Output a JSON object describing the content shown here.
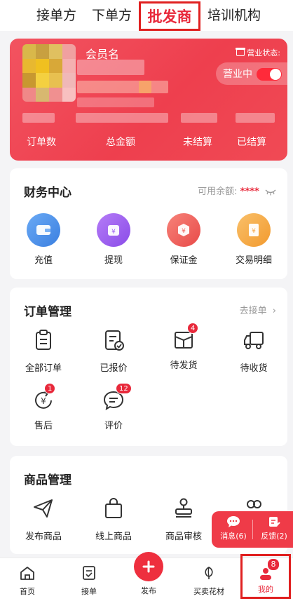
{
  "top_tabs": [
    "接单方",
    "下单方",
    "批发商",
    "培训机构"
  ],
  "member_card": {
    "name_label": "会员名",
    "status_label": "营业状态:",
    "status_value": "营业中",
    "status_on": true,
    "stats": [
      "订单数",
      "总金额",
      "未结算",
      "已结算"
    ]
  },
  "finance": {
    "title": "财务中心",
    "balance_label": "可用余额:",
    "balance_value": "****",
    "items": [
      {
        "label": "充值",
        "icon": "wallet-icon",
        "color": "#4a90e8"
      },
      {
        "label": "提现",
        "icon": "withdraw-icon",
        "color": "#9b5ef0"
      },
      {
        "label": "保证金",
        "icon": "deposit-icon",
        "color": "#f0605a"
      },
      {
        "label": "交易明细",
        "icon": "ledger-icon",
        "color": "#f5a645"
      }
    ]
  },
  "orders": {
    "title": "订单管理",
    "link": "去接单",
    "items": [
      {
        "label": "全部订单",
        "icon": "clipboard-icon",
        "badge": ""
      },
      {
        "label": "已报价",
        "icon": "quoted-icon",
        "badge": ""
      },
      {
        "label": "待发货",
        "icon": "box-icon",
        "badge": "4"
      },
      {
        "label": "待收货",
        "icon": "truck-icon",
        "badge": ""
      },
      {
        "label": "售后",
        "icon": "after-sale-icon",
        "badge": "1"
      },
      {
        "label": "评价",
        "icon": "comment-icon",
        "badge": "12"
      }
    ]
  },
  "products": {
    "title": "商品管理",
    "items": [
      {
        "label": "发布商品",
        "icon": "paper-plane-icon"
      },
      {
        "label": "线上商品",
        "icon": "bag-icon"
      },
      {
        "label": "商品审核",
        "icon": "stamp-icon"
      },
      {
        "label": "",
        "icon": "users-icon"
      }
    ]
  },
  "float_bubble": {
    "messages": "消息(6)",
    "feedback": "反馈(2)"
  },
  "bottom_nav": {
    "items": [
      "首页",
      "接单",
      "发布",
      "买卖花材",
      "我的"
    ],
    "me_badge": "8"
  },
  "colors": {
    "accent": "#e8293b",
    "card_red": "#ef4552"
  }
}
